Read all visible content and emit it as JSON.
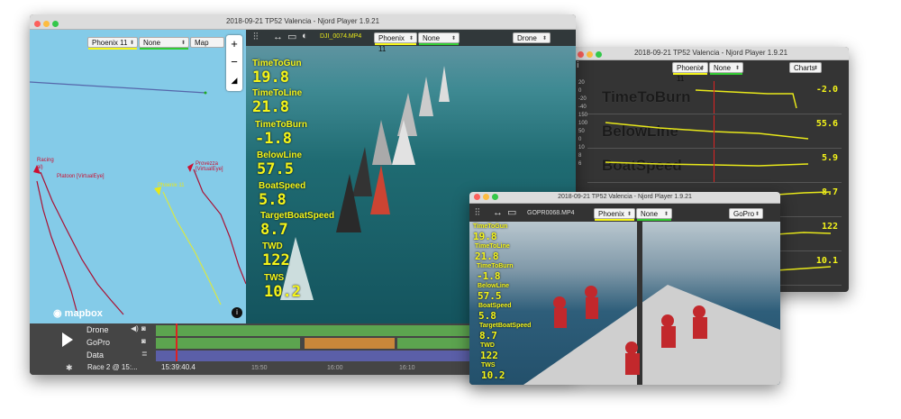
{
  "main_window": {
    "title": "2018-09-21 TP52 Valencia - Njord Player 1.9.21",
    "map_boat_select": "Phoenix 11",
    "map_compare_select": "None",
    "map_layer_select": "Map",
    "map_labels": {
      "racing": "Racing",
      "racing_sub": "al)",
      "platoon": "Platoon [VirtualEye]",
      "provezza": "Provezza [VirtualEye]",
      "phoenix": "Phoenix 11"
    },
    "mapbox_logo": "mapbox",
    "video_file": "DJI_0074.MP4",
    "video_boat_select": "Phoenix 11",
    "video_compare_select": "None",
    "video_source_select": "Drone",
    "metrics": [
      {
        "label": "TimeToGun",
        "value": "19.8"
      },
      {
        "label": "TimeToLine",
        "value": "21.8"
      },
      {
        "label": "TimeToBurn",
        "value": "-1.8"
      },
      {
        "label": "BelowLine",
        "value": "57.5"
      },
      {
        "label": "BoatSpeed",
        "value": "5.8"
      },
      {
        "label": "TargetBoatSpeed",
        "value": "8.7"
      },
      {
        "label": "TWD",
        "value": "122"
      },
      {
        "label": "TWS",
        "value": "10.2"
      }
    ],
    "timeline": {
      "tracks": [
        "Drone",
        "GoPro",
        "Data"
      ],
      "race_select": "Race 2 @ 15:...",
      "current_time": "15:39:40.4",
      "ticks": [
        "15:50",
        "16:00",
        "16:10"
      ]
    }
  },
  "charts_window": {
    "title": "2018-09-21 TP52 Valencia - Njord Player 1.9.21",
    "boat_select": "Phoenix 11",
    "compare_select": "None",
    "view_select": "Charts",
    "rows": [
      {
        "name": "TimeToBurn",
        "value": "-2.0",
        "ticks": [
          "20",
          "0",
          "-20",
          "-40"
        ]
      },
      {
        "name": "BelowLine",
        "value": "55.6",
        "ticks": [
          "150",
          "100",
          "50",
          "0"
        ]
      },
      {
        "name": "BoatSpeed",
        "value": "5.9",
        "ticks": [
          "10",
          "8",
          "6"
        ]
      },
      {
        "name": "",
        "value": "8.7",
        "ticks": []
      },
      {
        "name": "",
        "value": "122",
        "ticks": []
      },
      {
        "name": "",
        "value": "10.1",
        "ticks": []
      }
    ]
  },
  "gopro_window": {
    "title": "2018-09-21 TP52 Valencia - Njord Player 1.9.21",
    "video_file": "GOPR0068.MP4",
    "boat_select": "Phoenix 11",
    "compare_select": "None",
    "source_select": "GoPro",
    "metrics": [
      {
        "label": "TimeToGun",
        "value": "19.8"
      },
      {
        "label": "TimeToLine",
        "value": "21.8"
      },
      {
        "label": "TimeToBurn",
        "value": "-1.8"
      },
      {
        "label": "BelowLine",
        "value": "57.5"
      },
      {
        "label": "BoatSpeed",
        "value": "5.8"
      },
      {
        "label": "TargetBoatSpeed",
        "value": "8.7"
      },
      {
        "label": "TWD",
        "value": "122"
      },
      {
        "label": "TWS",
        "value": "10.2"
      }
    ]
  }
}
